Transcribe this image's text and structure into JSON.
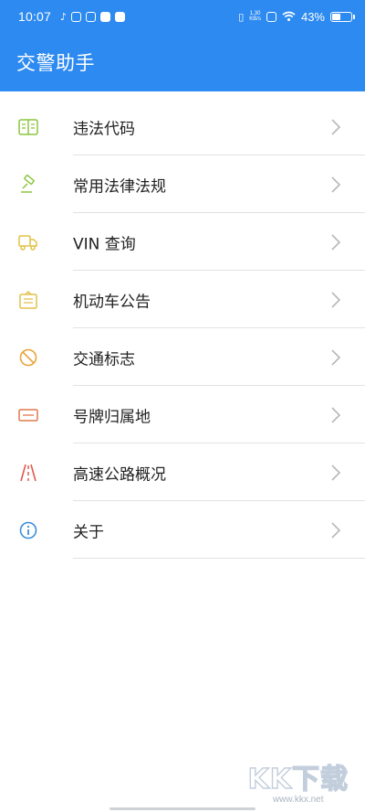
{
  "status_bar": {
    "time": "10:07",
    "net_speed_value": "1.30",
    "net_speed_unit": "KB/s",
    "battery_percent": "43%"
  },
  "app_bar": {
    "title": "交警助手"
  },
  "menu": {
    "items": [
      {
        "label": "违法代码",
        "icon": "book-icon",
        "icon_color": "#8cc63f"
      },
      {
        "label": "常用法律法规",
        "icon": "gavel-icon",
        "icon_color": "#8cc63f"
      },
      {
        "label": "VIN 查询",
        "icon": "truck-icon",
        "icon_color": "#e0c24a"
      },
      {
        "label": "机动车公告",
        "icon": "notice-icon",
        "icon_color": "#e0c24a"
      },
      {
        "label": "交通标志",
        "icon": "no-entry-icon",
        "icon_color": "#e8a43a"
      },
      {
        "label": "号牌归属地",
        "icon": "plate-icon",
        "icon_color": "#e07a4f"
      },
      {
        "label": "高速公路概况",
        "icon": "road-icon",
        "icon_color": "#e05a4f"
      },
      {
        "label": "关于",
        "icon": "info-icon",
        "icon_color": "#3a8fd8"
      }
    ]
  },
  "watermark": {
    "logo": "KK下载",
    "url": "www.kkx.net"
  }
}
